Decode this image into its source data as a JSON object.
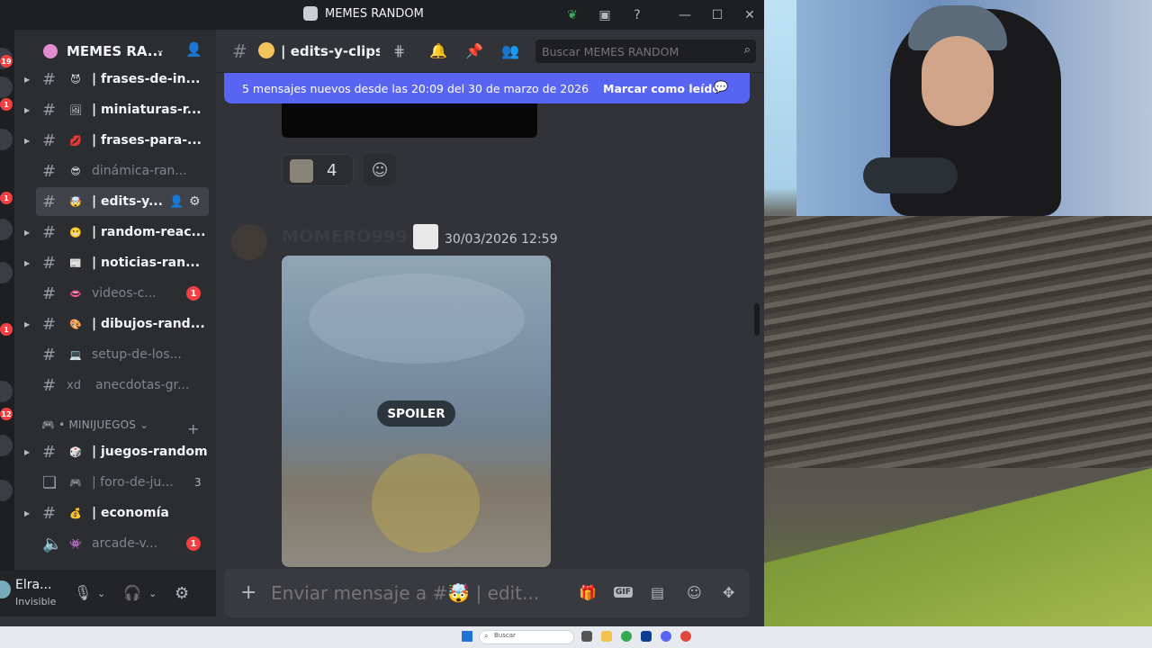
{
  "window": {
    "title": "MEMES RANDOM"
  },
  "rail": {
    "badges": [
      "19",
      "1",
      "1",
      "1",
      "12"
    ]
  },
  "server": {
    "name": "MEMES RA..."
  },
  "channels": [
    {
      "name": "| frases-de-in...",
      "emoji": "😈"
    },
    {
      "name": "| miniaturas-r...",
      "emoji": "🖼"
    },
    {
      "name": "| frases-para-...",
      "emoji": "💋"
    },
    {
      "name": "dinámica-ran...",
      "emoji": "😎"
    },
    {
      "name": "| edits-y...",
      "emoji": "🤯"
    },
    {
      "name": "| random-reac...",
      "emoji": "😬"
    },
    {
      "name": "| noticias-ran...",
      "emoji": "📰"
    },
    {
      "name": "videos-c...",
      "emoji": "👄",
      "mentions": "1"
    },
    {
      "name": "| dibujos-rand...",
      "emoji": "🎨"
    },
    {
      "name": "setup-de-los...",
      "emoji": "💻"
    },
    {
      "name": "anecdotas-gr...",
      "prefix": "xd"
    }
  ],
  "category": {
    "label": "🎮 • MINIJUEGOS ⌄",
    "add": "+"
  },
  "channels2": [
    {
      "name": "| juegos-random",
      "emoji": "🎲"
    },
    {
      "name": "| foro-de-ju...",
      "emoji": "🎮",
      "count": "3"
    },
    {
      "name": "| economía",
      "emoji": "💰"
    },
    {
      "name": "arcade-v...",
      "emoji": "👾",
      "mentions": "1"
    }
  ],
  "user": {
    "name": "Elra...",
    "status": "Invisible"
  },
  "header": {
    "channel": "| edits-y-clips-r",
    "search_placeholder": "Buscar MEMES RANDOM"
  },
  "banner": {
    "text": "5 mensajes nuevos desde las 20:09 del 30 de marzo de 2026",
    "action": "Marcar como leído"
  },
  "message": {
    "reaction_count": "4",
    "author": "MOMERO999",
    "timestamp": "30/03/2026 12:59",
    "spoiler_label": "SPOILER"
  },
  "composer": {
    "placeholder": "Enviar mensaje a #🤯 | edit..."
  },
  "taskbar": {
    "search": "Buscar"
  },
  "colors": {
    "accent": "#5865f2",
    "mention_red": "#f23f43",
    "bg": "#313338",
    "sidebar": "#2b2d31"
  }
}
